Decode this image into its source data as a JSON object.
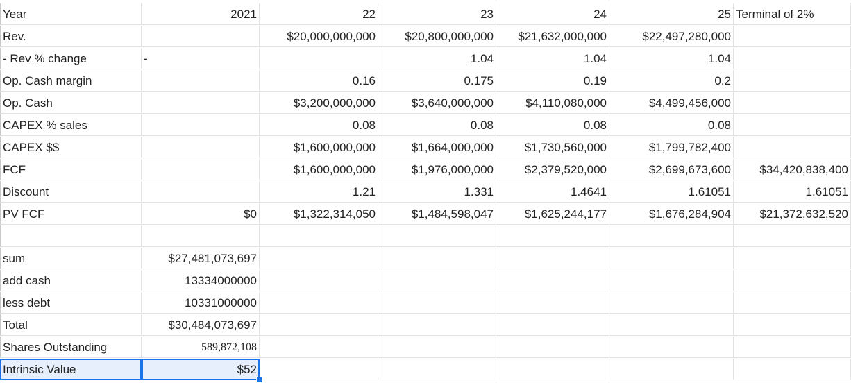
{
  "sheet": {
    "rows": [
      [
        "Year",
        "2021",
        "22",
        "23",
        "24",
        "25",
        "Terminal of 2%"
      ],
      [
        "Rev.",
        "",
        "$20,000,000,000",
        "$20,800,000,000",
        "$21,632,000,000",
        "$22,497,280,000",
        ""
      ],
      [
        "- Rev % change",
        "-",
        "",
        "1.04",
        "1.04",
        "1.04",
        ""
      ],
      [
        "Op. Cash margin",
        "",
        "0.16",
        "0.175",
        "0.19",
        "0.2",
        ""
      ],
      [
        "Op. Cash",
        "",
        "$3,200,000,000",
        "$3,640,000,000",
        "$4,110,080,000",
        "$4,499,456,000",
        ""
      ],
      [
        "CAPEX % sales",
        "",
        "0.08",
        "0.08",
        "0.08",
        "0.08",
        ""
      ],
      [
        "CAPEX $$",
        "",
        "$1,600,000,000",
        "$1,664,000,000",
        "$1,730,560,000",
        "$1,799,782,400",
        ""
      ],
      [
        "FCF",
        "",
        "$1,600,000,000",
        "$1,976,000,000",
        "$2,379,520,000",
        "$2,699,673,600",
        "$34,420,838,400"
      ],
      [
        "Discount",
        "",
        "1.21",
        "1.331",
        "1.4641",
        "1.61051",
        "1.61051"
      ],
      [
        "PV FCF",
        "$0",
        "$1,322,314,050",
        "$1,484,598,047",
        "$1,625,244,177",
        "$1,676,284,904",
        "$21,372,632,520"
      ],
      [
        "",
        "",
        "",
        "",
        "",
        "",
        ""
      ],
      [
        "sum",
        "$27,481,073,697",
        "",
        "",
        "",
        "",
        ""
      ],
      [
        "add cash",
        "13334000000",
        "",
        "",
        "",
        "",
        ""
      ],
      [
        "less debt",
        "10331000000",
        "",
        "",
        "",
        "",
        ""
      ],
      [
        "Total",
        "$30,484,073,697",
        "",
        "",
        "",
        "",
        ""
      ],
      [
        "Shares Outstanding",
        "589,872,108",
        "",
        "",
        "",
        "",
        ""
      ],
      [
        "Intrinsic Value",
        "$52",
        "",
        "",
        "",
        "",
        ""
      ]
    ]
  }
}
